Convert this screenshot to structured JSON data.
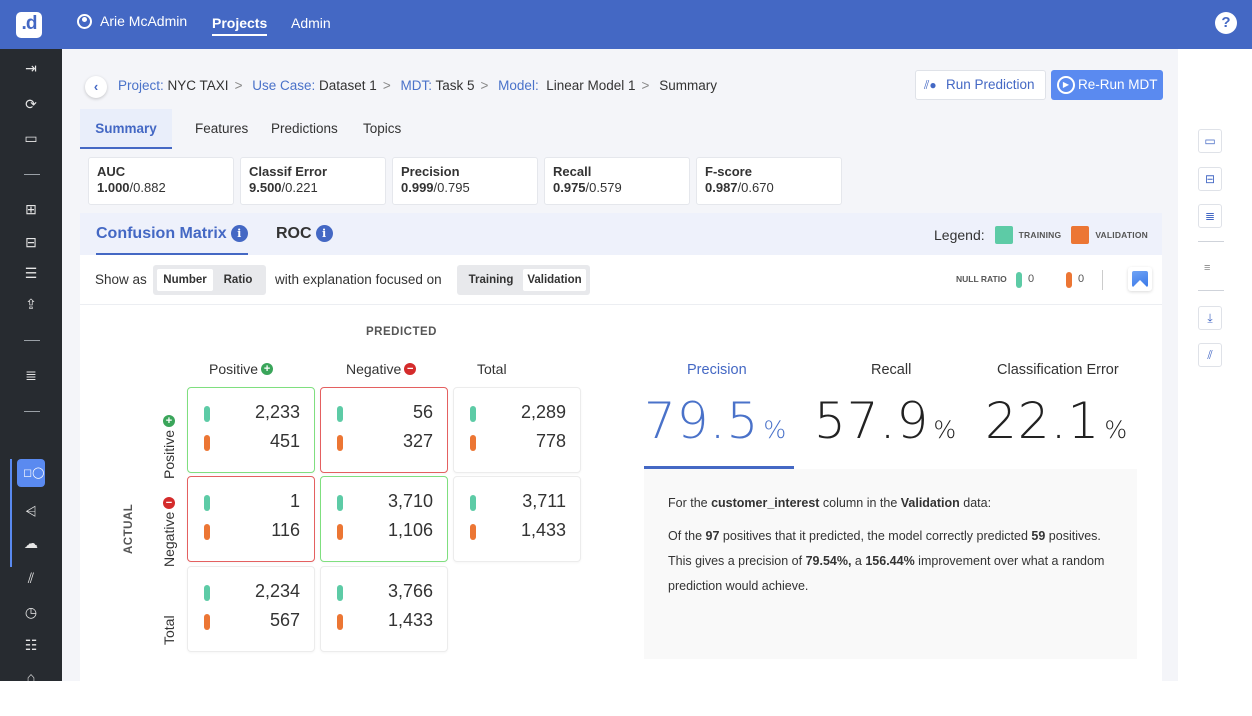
{
  "topbar": {
    "logo": ".d",
    "user_name": "Arie McAdmin",
    "nav": [
      "Projects",
      "Admin"
    ],
    "active_nav": "Projects",
    "help_icon": "?"
  },
  "breadcrumb": {
    "items": [
      {
        "key": "Project:",
        "value": "NYC TAXI"
      },
      {
        "key": "Use Case:",
        "value": "Dataset 1"
      },
      {
        "key": "MDT:",
        "value": "Task 5"
      },
      {
        "key": "Model:",
        "value": "Linear Model 1"
      },
      {
        "key": "",
        "value": "Summary"
      }
    ],
    "separator": ">"
  },
  "actions": {
    "run_prediction": "Run Prediction",
    "rerun_mdt": "Re-Run MDT"
  },
  "tabs": [
    "Summary",
    "Features",
    "Predictions",
    "Topics"
  ],
  "active_tab": "Summary",
  "metrics": [
    {
      "label": "AUC",
      "train": "1.000",
      "valid": "/0.882"
    },
    {
      "label": "Classif Error",
      "train": "9.500",
      "valid": "/0.221"
    },
    {
      "label": "Precision",
      "train": "0.999",
      "valid": "/0.795"
    },
    {
      "label": "Recall",
      "train": "0.975",
      "valid": "/0.579"
    },
    {
      "label": "F-score",
      "train": "0.987",
      "valid": "/0.670"
    }
  ],
  "subtabs": {
    "confusion_matrix": "Confusion Matrix",
    "roc": "ROC",
    "info_icon": "i"
  },
  "legend": {
    "label": "Legend:",
    "training": "TRAINING",
    "validation": "VALIDATION",
    "training_color": "#5dcba6",
    "validation_color": "#ec7634"
  },
  "controls": {
    "show_as": "Show as",
    "number": "Number",
    "ratio": "Ratio",
    "explanation": "with explanation focused on",
    "training": "Training",
    "validation": "Validation",
    "null_ratio": "NULL RATIO",
    "null_training": "0",
    "null_validation": "0"
  },
  "matrix": {
    "predicted_label": "PREDICTED",
    "actual_label": "ACTUAL",
    "col_headers": [
      "Positive",
      "Negative",
      "Total"
    ],
    "row_headers": [
      "Positive",
      "Negative",
      "Total"
    ],
    "cells": {
      "pos_pos": {
        "train": "2,233",
        "valid": "451"
      },
      "pos_neg": {
        "train": "56",
        "valid": "327"
      },
      "pos_tot": {
        "train": "2,289",
        "valid": "778"
      },
      "neg_pos": {
        "train": "1",
        "valid": "116"
      },
      "neg_neg": {
        "train": "3,710",
        "valid": "1,106"
      },
      "neg_tot": {
        "train": "3,711",
        "valid": "1,433"
      },
      "tot_pos": {
        "train": "2,234",
        "valid": "567"
      },
      "tot_neg": {
        "train": "3,766",
        "valid": "1,433"
      }
    }
  },
  "stats": {
    "precision": {
      "label": "Precision",
      "value": "79.5"
    },
    "recall": {
      "label": "Recall",
      "value": "57.9"
    },
    "class_error": {
      "label": "Classification Error",
      "value": "22.1"
    },
    "percent": "%"
  },
  "explanation": {
    "l1_a": "For the ",
    "l1_col": "customer_interest",
    "l1_b": " column in the ",
    "l1_data": "Validation",
    "l1_c": " data:",
    "l2_a": "Of the ",
    "l2_n1": "97",
    "l2_b": " positives that it predicted, the model correctly predicted ",
    "l2_n2": "59",
    "l2_c": " positives. This gives a precision of ",
    "l2_p1": "79.54%, ",
    "l2_d": "a ",
    "l2_p2": "156.44%",
    "l2_e": " improvement over what a random prediction would achieve."
  }
}
